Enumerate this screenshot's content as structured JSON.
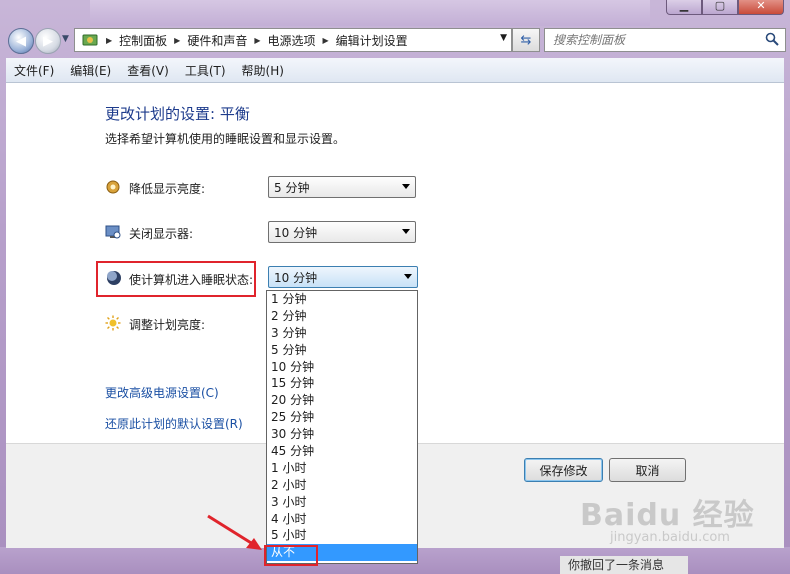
{
  "address_bar": {
    "crumbs": [
      "控制面板",
      "硬件和声音",
      "电源选项",
      "编辑计划设置"
    ]
  },
  "search": {
    "placeholder": "搜索控制面板"
  },
  "menu": [
    "文件(F)",
    "编辑(E)",
    "查看(V)",
    "工具(T)",
    "帮助(H)"
  ],
  "content": {
    "heading": "更改计划的设置: 平衡",
    "subheading": "选择希望计算机使用的睡眠设置和显示设置。",
    "rows": [
      {
        "label": "降低显示亮度:",
        "value": "5 分钟",
        "icon": "brightness-dim-icon"
      },
      {
        "label": "关闭显示器:",
        "value": "10 分钟",
        "icon": "monitor-icon"
      },
      {
        "label": "使计算机进入睡眠状态:",
        "value": "10 分钟",
        "icon": "sleep-moon-icon"
      },
      {
        "label": "调整计划亮度:",
        "icon": "sun-icon"
      }
    ],
    "links": {
      "advanced": "更改高级电源设置(C)",
      "restore": "还原此计划的默认设置(R)"
    }
  },
  "dropdown_options": [
    "1 分钟",
    "2 分钟",
    "3 分钟",
    "5 分钟",
    "10 分钟",
    "15 分钟",
    "20 分钟",
    "25 分钟",
    "30 分钟",
    "45 分钟",
    "1 小时",
    "2 小时",
    "3 小时",
    "4 小时",
    "5 小时",
    "从不"
  ],
  "dropdown_selected": "从不",
  "buttons": {
    "save": "保存修改",
    "cancel": "取消"
  },
  "watermark": {
    "logo": "Baidu 经验",
    "url": "jingyan.baidu.com"
  },
  "notification": "你撤回了一条消息",
  "colors": {
    "highlight_red": "#e0242c",
    "selection_blue": "#3399ff",
    "heading_blue": "#1d3b8c",
    "link_blue": "#1a4fa3"
  }
}
